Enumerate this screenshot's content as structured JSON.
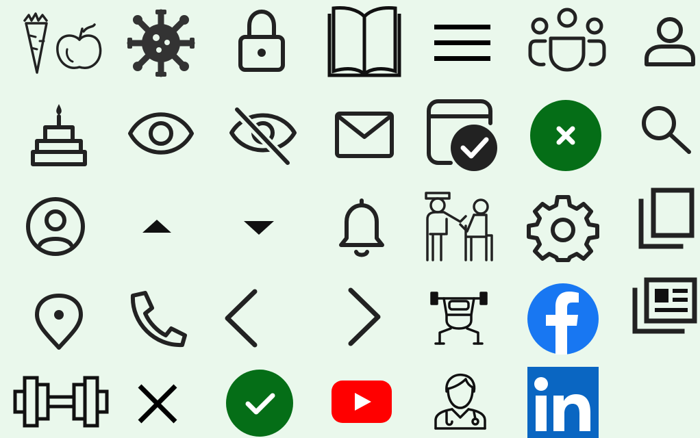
{
  "sheet": {
    "background": "#eaf8ec",
    "icon_color": "#222222",
    "icons": [
      "vegetables-fruit-icon",
      "virus-icon",
      "lock-icon",
      "open-book-icon",
      "menu-icon",
      "group-icon",
      "user-icon",
      "birthday-cake-icon",
      "eye-icon",
      "eye-off-icon",
      "mail-icon",
      "calendar-check-icon",
      "close-circle-icon",
      "search-icon",
      "account-circle-icon",
      "caret-up-icon",
      "caret-down-icon",
      "bell-icon",
      "caregiver-icon",
      "gear-icon",
      "copy-icon",
      "location-pin-icon",
      "phone-icon",
      "chevron-left-icon",
      "chevron-right-icon",
      "weightlifter-icon",
      "facebook-icon",
      "news-icon",
      "dumbbell-icon",
      "close-icon",
      "check-circle-icon",
      "youtube-icon",
      "doctor-icon",
      "linkedin-icon"
    ]
  },
  "colors": {
    "close_circle": "#056e17",
    "check_circle": "#056e17",
    "facebook": "#1877f2",
    "youtube": "#ff0000",
    "linkedin": "#0a66c2"
  },
  "linkedin": {
    "text": "in"
  }
}
